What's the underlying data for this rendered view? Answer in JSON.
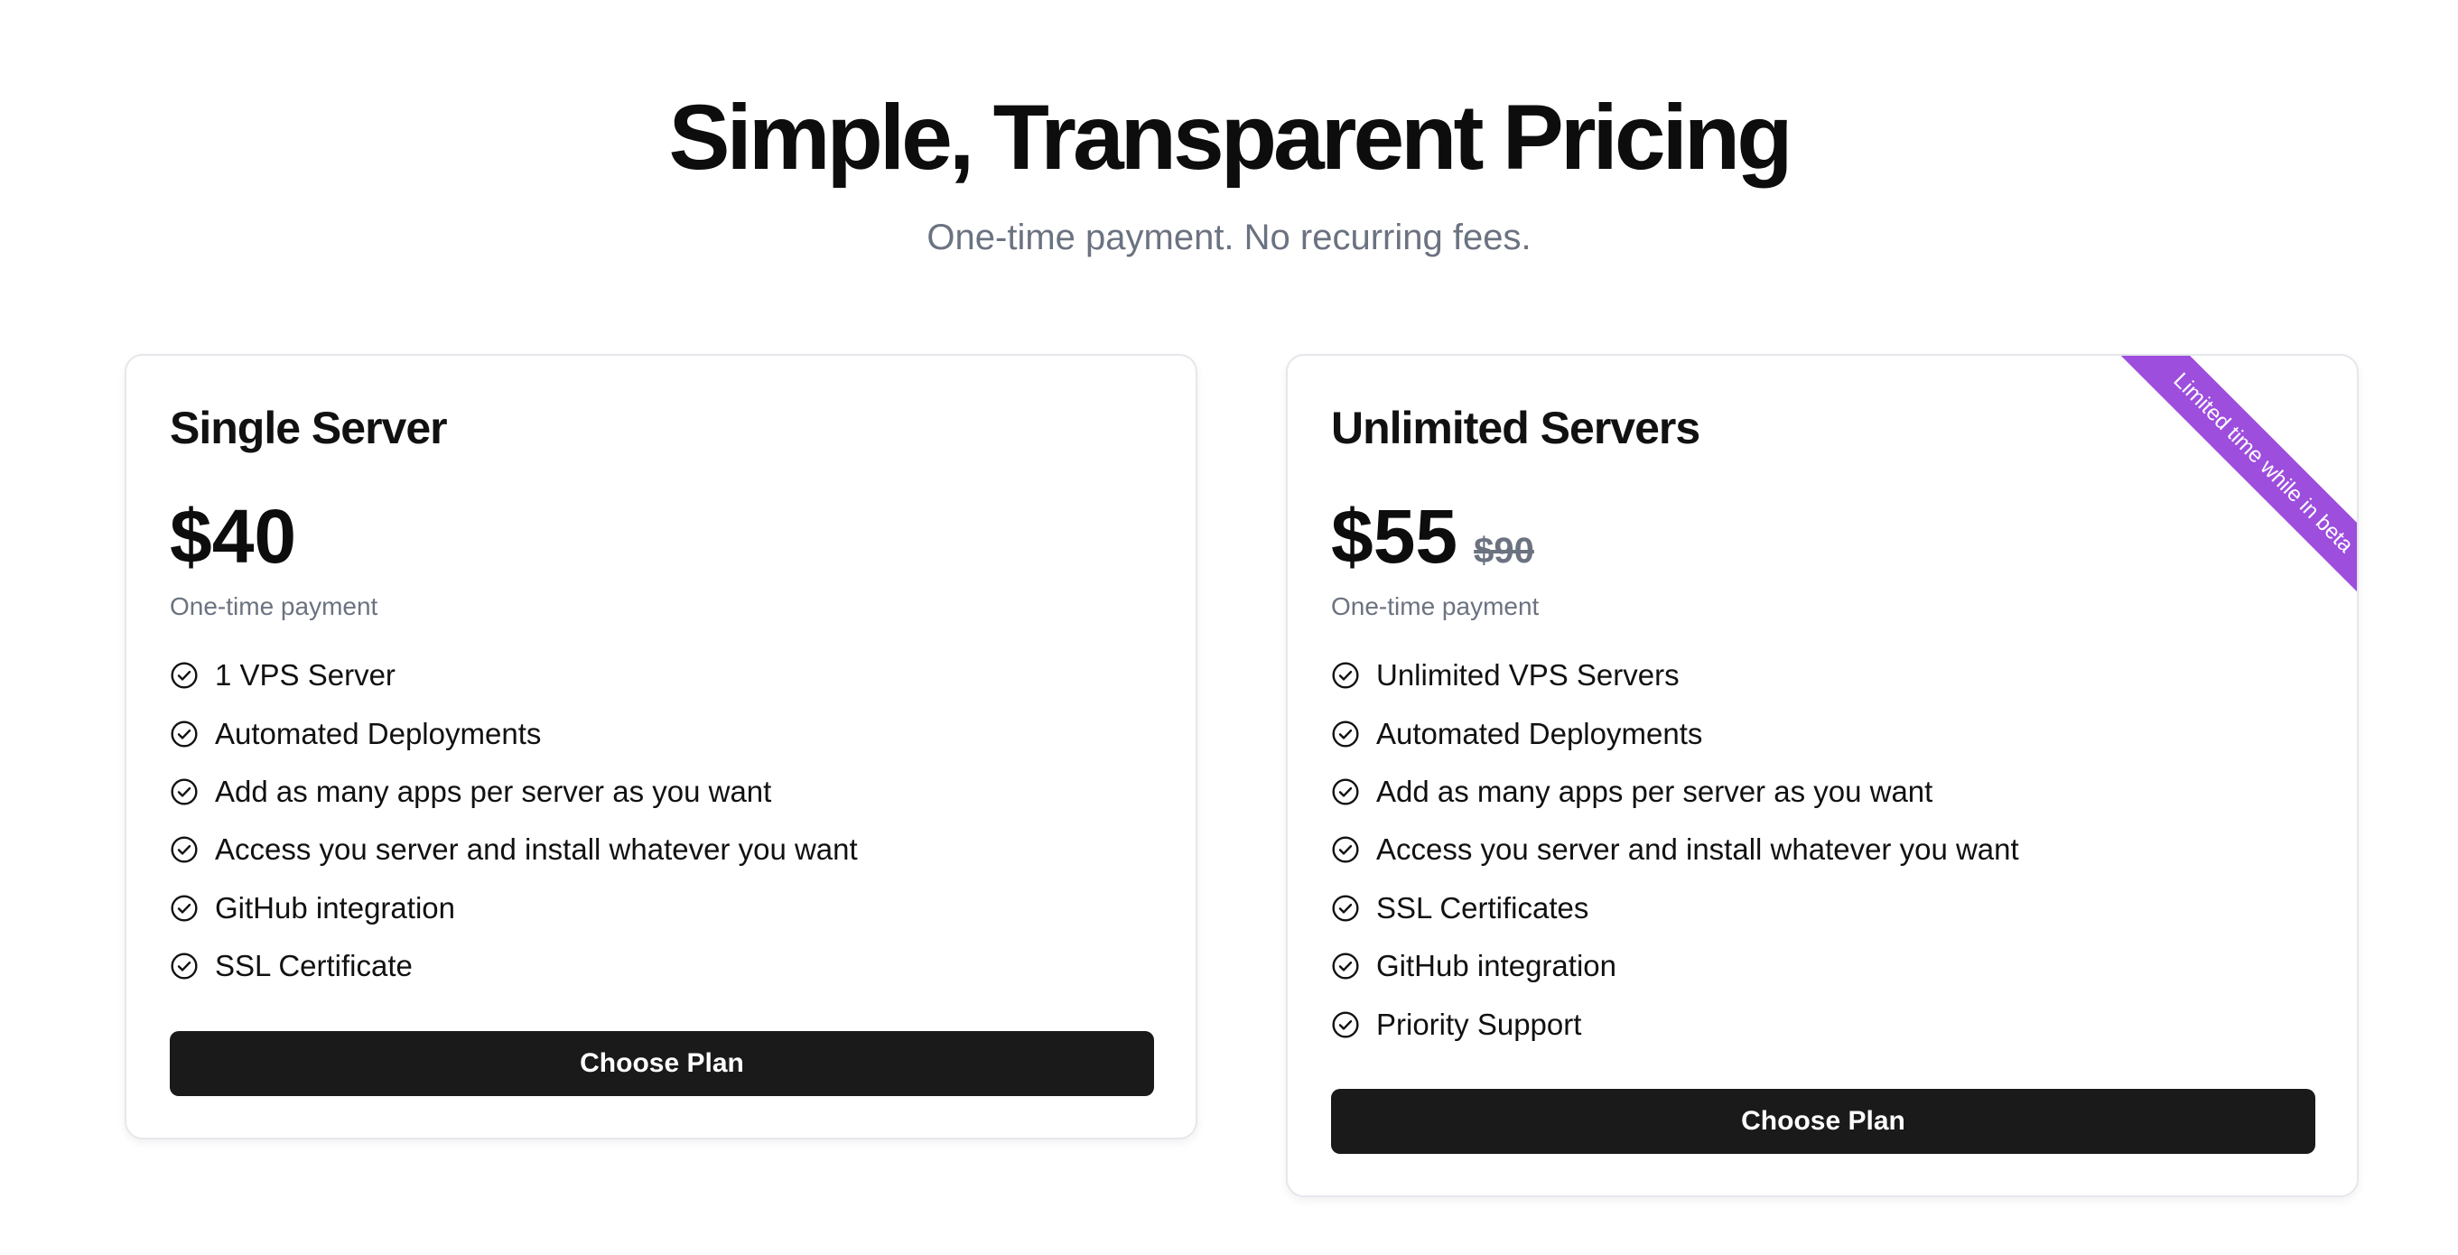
{
  "header": {
    "title": "Simple, Transparent Pricing",
    "subtitle": "One-time payment. No recurring fees."
  },
  "plans": [
    {
      "name": "Single Server",
      "price": "$40",
      "price_note": "One-time payment",
      "features": [
        "1 VPS Server",
        "Automated Deployments",
        "Add as many apps per server as you want",
        "Access you server and install whatever you want",
        "GitHub integration",
        "SSL Certificate"
      ],
      "button_label": "Choose Plan"
    },
    {
      "name": "Unlimited Servers",
      "price": "$55",
      "old_price": "$90",
      "price_note": "One-time payment",
      "ribbon": "Limited time while in beta",
      "features": [
        "Unlimited VPS Servers",
        "Automated Deployments",
        "Add as many apps per server as you want",
        "Access you server and install whatever you want",
        "SSL Certificates",
        "GitHub integration",
        "Priority Support"
      ],
      "button_label": "Choose Plan"
    }
  ],
  "icons": {
    "feature": "check-circle-icon"
  },
  "colors": {
    "button_bg": "#1a1a1a",
    "ribbon_bg": "#9d4edd",
    "muted_text": "#6b7280"
  }
}
